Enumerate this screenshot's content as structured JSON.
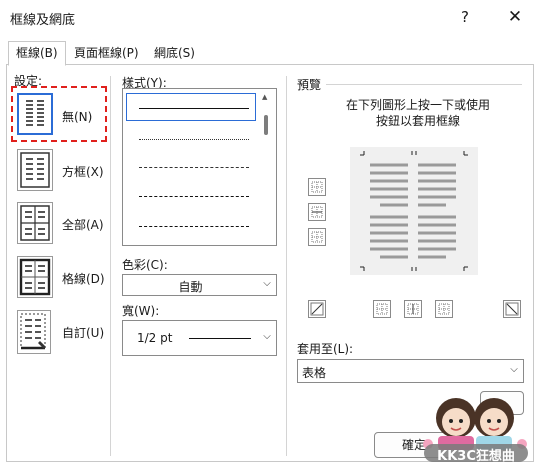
{
  "window": {
    "title": "框線及網底",
    "help_glyph": "?",
    "close_glyph": "✕"
  },
  "tabs": [
    {
      "label": "框線(B)"
    },
    {
      "label": "頁面框線(P)"
    },
    {
      "label": "網底(S)"
    }
  ],
  "setting": {
    "label": "設定:",
    "items": [
      {
        "label": "無(N)"
      },
      {
        "label": "方框(X)"
      },
      {
        "label": "全部(A)"
      },
      {
        "label": "格線(D)"
      },
      {
        "label": "自訂(U)"
      }
    ]
  },
  "style": {
    "label": "樣式(Y):"
  },
  "color": {
    "label": "色彩(C):",
    "value": "自動"
  },
  "width": {
    "label": "寬(W):",
    "value": "1/2 pt"
  },
  "preview": {
    "label": "預覽",
    "hint_line1": "在下列圖形上按一下或使用",
    "hint_line2": "按鈕以套用框線"
  },
  "apply_to": {
    "label": "套用至(L):",
    "value": "表格"
  },
  "buttons": {
    "ok": "確定"
  },
  "watermark": {
    "text": "KK3C狂想曲"
  }
}
